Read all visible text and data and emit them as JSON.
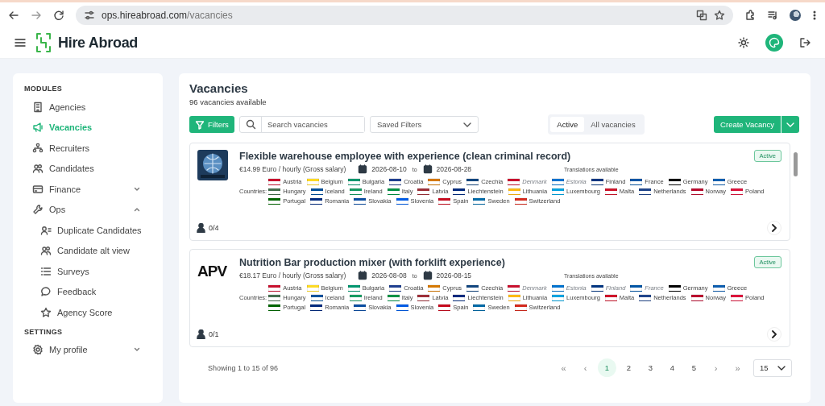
{
  "browser": {
    "url_host": "ops.hireabroad.com",
    "url_path": "/vacancies"
  },
  "header": {
    "brand": "Hire Abroad"
  },
  "sidebar": {
    "sections": [
      {
        "title": "MODULES",
        "items": [
          {
            "label": "Agencies",
            "selected": false
          },
          {
            "label": "Vacancies",
            "selected": true
          },
          {
            "label": "Recruiters",
            "selected": false
          },
          {
            "label": "Candidates",
            "selected": false
          },
          {
            "label": "Finance",
            "selected": false,
            "expanded": false
          },
          {
            "label": "Ops",
            "selected": false,
            "expanded": true,
            "children": [
              {
                "label": "Duplicate Candidates",
                "selected": false
              },
              {
                "label": "Candidate alt view",
                "selected": false
              },
              {
                "label": "Surveys",
                "selected": false
              },
              {
                "label": "Feedback",
                "selected": false
              },
              {
                "label": "Agency Score",
                "selected": false
              }
            ]
          }
        ]
      },
      {
        "title": "SETTINGS",
        "items": [
          {
            "label": "My profile",
            "selected": false,
            "expanded": false
          }
        ]
      }
    ]
  },
  "page": {
    "title": "Vacancies",
    "subtitle": "96 vacancies available"
  },
  "toolbar": {
    "filters_button": "Filters",
    "search": {
      "placeholder": "Search vacancies"
    },
    "saved_filters": {
      "placeholder": "Saved Filters"
    },
    "tabs": [
      {
        "label": "Active",
        "selected": true
      },
      {
        "label": "All vacancies",
        "selected": false
      }
    ],
    "create_button": "Create Vacancy"
  },
  "vacancies": [
    {
      "title": "Flexible warehouse employee with experience (clean criminal record)",
      "status": "Active",
      "salary": "€14.99 Euro / hourly (Gross salary)",
      "date_from": "2026-08-10",
      "date_sep": "to",
      "date_to": "2026-08-28",
      "translations": "Translations available",
      "countries_label": "Countries:",
      "applicants": "0/4",
      "country_rows": [
        [
          {
            "name": "Austria",
            "color": "#c8102e",
            "dimmed": false
          },
          {
            "name": "Belgium",
            "color": "#fdda24",
            "dimmed": false
          },
          {
            "name": "Bulgaria",
            "color": "#00966e",
            "dimmed": false
          },
          {
            "name": "Croatia",
            "color": "#1f3f8f",
            "dimmed": false
          },
          {
            "name": "Cyprus",
            "color": "#d57800",
            "dimmed": false
          },
          {
            "name": "Czechia",
            "color": "#11457e",
            "dimmed": false
          },
          {
            "name": "Denmark",
            "color": "#c8102e",
            "dimmed": true
          },
          {
            "name": "Estonia",
            "color": "#0072ce",
            "dimmed": true
          },
          {
            "name": "Finland",
            "color": "#003580",
            "dimmed": false
          },
          {
            "name": "France",
            "color": "#0055a4",
            "dimmed": false
          },
          {
            "name": "Germany",
            "color": "#000000",
            "dimmed": false
          },
          {
            "name": "Greece",
            "color": "#0d5eaf",
            "dimmed": false
          }
        ],
        [
          {
            "name": "Hungary",
            "color": "#477050",
            "dimmed": false
          },
          {
            "name": "Iceland",
            "color": "#02529c",
            "dimmed": false
          },
          {
            "name": "Ireland",
            "color": "#169b62",
            "dimmed": false
          },
          {
            "name": "Italy",
            "color": "#009246",
            "dimmed": false
          },
          {
            "name": "Latvia",
            "color": "#9e3039",
            "dimmed": false
          },
          {
            "name": "Liechtenstein",
            "color": "#002b7f",
            "dimmed": false
          },
          {
            "name": "Lithuania",
            "color": "#fdb913",
            "dimmed": false
          },
          {
            "name": "Luxembourg",
            "color": "#00a3e0",
            "dimmed": false
          },
          {
            "name": "Malta",
            "color": "#cf142b",
            "dimmed": false
          },
          {
            "name": "Netherlands",
            "color": "#21468b",
            "dimmed": false
          },
          {
            "name": "Norway",
            "color": "#ba0c2f",
            "dimmed": false
          },
          {
            "name": "Poland",
            "color": "#dc143c",
            "dimmed": false
          }
        ],
        [
          {
            "name": "Portugal",
            "color": "#006600",
            "dimmed": false
          },
          {
            "name": "Romania",
            "color": "#002b7f",
            "dimmed": false
          },
          {
            "name": "Slovakia",
            "color": "#0b4ea2",
            "dimmed": false
          },
          {
            "name": "Slovenia",
            "color": "#005ce5",
            "dimmed": false
          },
          {
            "name": "Spain",
            "color": "#c60b1e",
            "dimmed": false
          },
          {
            "name": "Sweden",
            "color": "#006aa7",
            "dimmed": false
          },
          {
            "name": "Switzerland",
            "color": "#d52b1e",
            "dimmed": false
          }
        ]
      ]
    },
    {
      "logo": {
        "kind": "text",
        "text": "APV"
      },
      "title": "Nutrition Bar production mixer (with forklift experience)",
      "status": "Active",
      "salary": "€18.17 Euro / hourly (Gross salary)",
      "date_from": "2026-08-08",
      "date_sep": "to",
      "date_to": "2026-08-15",
      "translations": "Translations available",
      "countries_label": "Countries:",
      "applicants": "0/1",
      "country_rows": [
        [
          {
            "name": "Austria",
            "color": "#c8102e",
            "dimmed": false
          },
          {
            "name": "Belgium",
            "color": "#fdda24",
            "dimmed": false
          },
          {
            "name": "Bulgaria",
            "color": "#00966e",
            "dimmed": false
          },
          {
            "name": "Croatia",
            "color": "#1f3f8f",
            "dimmed": false
          },
          {
            "name": "Cyprus",
            "color": "#d57800",
            "dimmed": false
          },
          {
            "name": "Czechia",
            "color": "#11457e",
            "dimmed": false
          },
          {
            "name": "Denmark",
            "color": "#c8102e",
            "dimmed": true
          },
          {
            "name": "Estonia",
            "color": "#0072ce",
            "dimmed": true
          },
          {
            "name": "Finland",
            "color": "#003580",
            "dimmed": true
          },
          {
            "name": "France",
            "color": "#0055a4",
            "dimmed": true
          },
          {
            "name": "Germany",
            "color": "#000000",
            "dimmed": false
          },
          {
            "name": "Greece",
            "color": "#0d5eaf",
            "dimmed": false
          }
        ],
        [
          {
            "name": "Hungary",
            "color": "#477050",
            "dimmed": false
          },
          {
            "name": "Iceland",
            "color": "#02529c",
            "dimmed": false
          },
          {
            "name": "Ireland",
            "color": "#169b62",
            "dimmed": false
          },
          {
            "name": "Italy",
            "color": "#009246",
            "dimmed": false
          },
          {
            "name": "Latvia",
            "color": "#9e3039",
            "dimmed": false
          },
          {
            "name": "Liechtenstein",
            "color": "#002b7f",
            "dimmed": false
          },
          {
            "name": "Lithuania",
            "color": "#fdb913",
            "dimmed": false
          },
          {
            "name": "Luxembourg",
            "color": "#00a3e0",
            "dimmed": false
          },
          {
            "name": "Malta",
            "color": "#cf142b",
            "dimmed": false
          },
          {
            "name": "Netherlands",
            "color": "#21468b",
            "dimmed": false
          },
          {
            "name": "Norway",
            "color": "#ba0c2f",
            "dimmed": false
          },
          {
            "name": "Poland",
            "color": "#dc143c",
            "dimmed": false
          }
        ],
        [
          {
            "name": "Portugal",
            "color": "#006600",
            "dimmed": false
          },
          {
            "name": "Romania",
            "color": "#002b7f",
            "dimmed": false
          },
          {
            "name": "Slovakia",
            "color": "#0b4ea2",
            "dimmed": false
          },
          {
            "name": "Slovenia",
            "color": "#005ce5",
            "dimmed": false
          },
          {
            "name": "Spain",
            "color": "#c60b1e",
            "dimmed": false
          },
          {
            "name": "Sweden",
            "color": "#006aa7",
            "dimmed": false
          },
          {
            "name": "Switzerland",
            "color": "#d52b1e",
            "dimmed": false
          }
        ]
      ]
    }
  ],
  "pagination": {
    "summary": "Showing 1 to 15 of 96",
    "first": "«",
    "prev": "‹",
    "pages": [
      {
        "label": "1",
        "selected": true
      },
      {
        "label": "2",
        "selected": false
      },
      {
        "label": "3",
        "selected": false
      },
      {
        "label": "4",
        "selected": false
      },
      {
        "label": "5",
        "selected": false
      }
    ],
    "next": "›",
    "last": "»",
    "page_size": "15"
  }
}
